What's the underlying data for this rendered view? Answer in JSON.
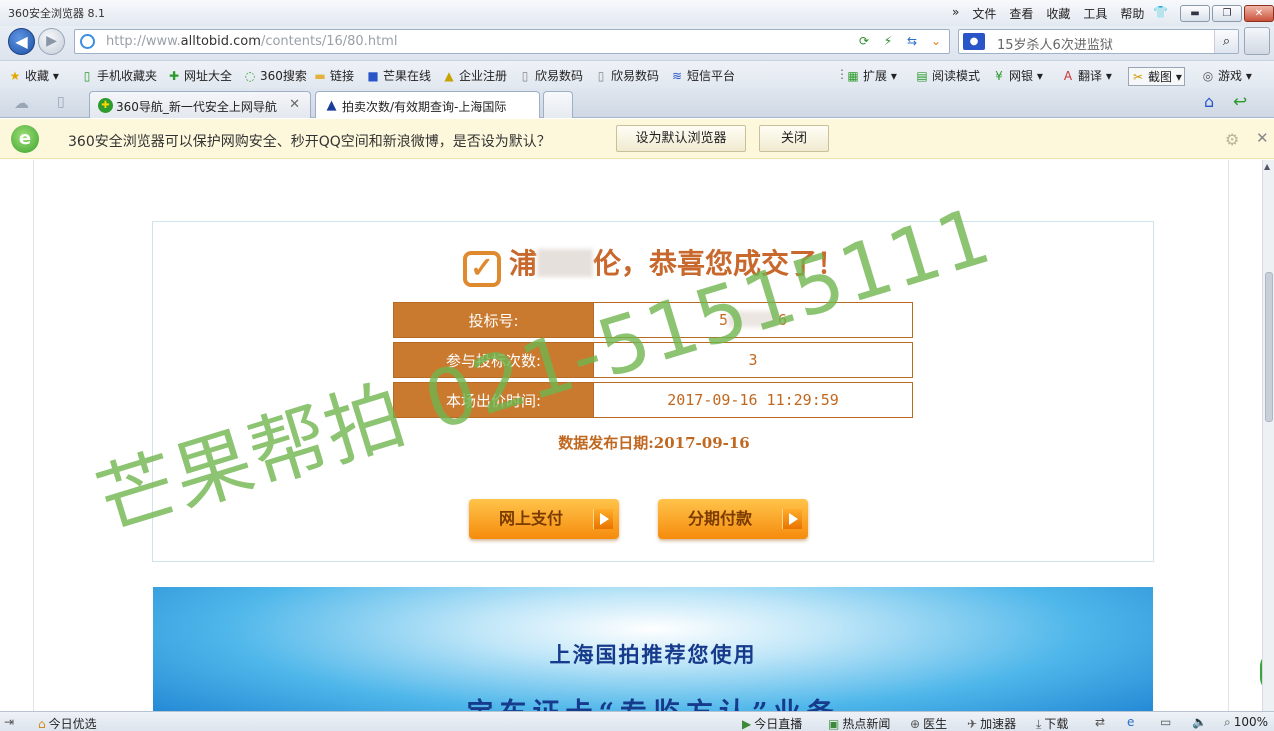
{
  "window": {
    "title": "360安全浏览器 8.1",
    "menus": [
      "»",
      "文件",
      "查看",
      "收藏",
      "工具",
      "帮助"
    ]
  },
  "nav": {
    "url_prefix": "http://www.",
    "url_domain": "alltobid.com",
    "url_path": "/contents/16/80.html",
    "search_text": "15岁杀人6次进监狱"
  },
  "bookmarks": {
    "items": [
      "收藏",
      "手机收藏夹",
      "网址大全",
      "360搜索",
      "链接",
      "芒果在线",
      "企业注册",
      "欣易数码",
      "欣易数码",
      "短信平台"
    ],
    "right_items": [
      "扩展",
      "阅读模式",
      "网银",
      "翻译",
      "截图",
      "游戏"
    ]
  },
  "tabs": [
    {
      "label": "360导航_新一代安全上网导航"
    },
    {
      "label": "拍卖次数/有效期查询-上海国际"
    }
  ],
  "infobar": {
    "message": "360安全浏览器可以保护网购安全、秒开QQ空间和新浪微博，是否设为默认？",
    "set_default": "设为默认浏览器",
    "close": "关闭"
  },
  "result": {
    "name_first": "浦",
    "congrats_suffix": "伦，恭喜您成交了！",
    "rows": [
      {
        "label": "投标号:",
        "value_pre": "5",
        "value_post": "6"
      },
      {
        "label": "参与投标次数:",
        "value": "3"
      },
      {
        "label": "本场出价时间:",
        "value": "2017-09-16 11:29:59"
      }
    ],
    "publish_label": "数据发布日期:",
    "publish_date": "2017-09-16",
    "pay_online": "网上支付",
    "pay_installment": "分期付款"
  },
  "banner": {
    "line1": "上海国拍推荐您使用",
    "line2": "宝车证卡“专监方认”业务"
  },
  "watermark": "芒果帮拍 021-51515111",
  "statusbar": {
    "left": "今日优选",
    "items": [
      "今日直播",
      "热点新闻",
      "医生",
      "加速器",
      "下载"
    ],
    "zoom": "100%"
  }
}
